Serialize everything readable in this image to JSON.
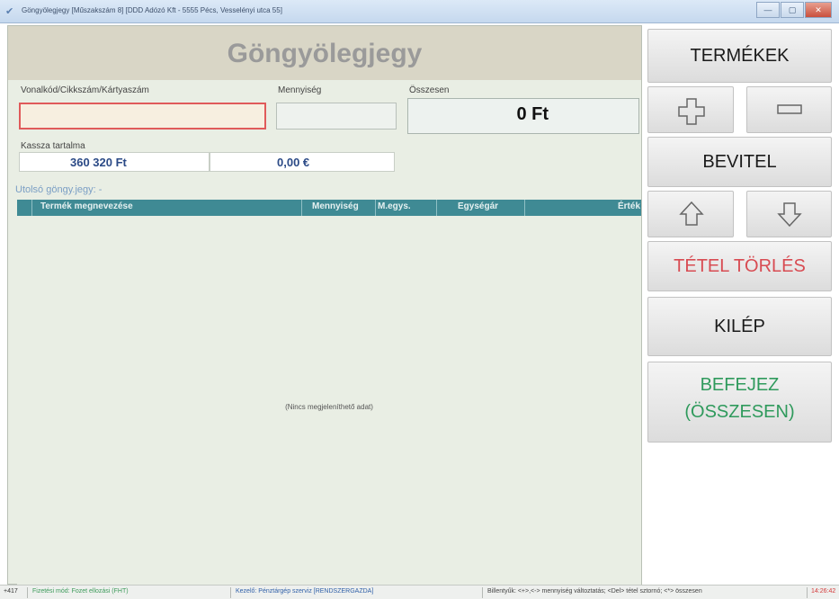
{
  "window": {
    "title": "Göngyölegjegy [Műszakszám 8] [DDD Adózó Kft - 5555 Pécs, Vesselényi utca 55]",
    "buttons": {
      "minimize": "—",
      "maximize": "▢",
      "close": "✕"
    }
  },
  "header": {
    "title": "Göngyölegjegy"
  },
  "form": {
    "barcode": {
      "label": "Vonalkód/Cikkszám/Kártyaszám",
      "value": ""
    },
    "quantity": {
      "label": "Mennyiség",
      "value": ""
    },
    "total": {
      "label": "Összesen",
      "value": "0 Ft"
    }
  },
  "kassza": {
    "label": "Kassza tartalma",
    "huf": "360 320 Ft",
    "eur": "0,00 €"
  },
  "last_ticket": {
    "label": "Utolsó göngy.jegy: -"
  },
  "grid": {
    "columns": [
      "Termék megnevezése",
      "Mennyiség",
      "M.egys.",
      "Egységár",
      "Érték"
    ],
    "empty_text": "(Nincs megjeleníthető adat)"
  },
  "sidebar": {
    "termekek": "TERMÉKEK",
    "plus_icon": "plus-icon",
    "minus_icon": "minus-icon",
    "bevitel": "BEVITEL",
    "up_icon": "arrow-up-icon",
    "down_icon": "arrow-down-icon",
    "tetel_torles": "TÉTEL TÖRLÉS",
    "kilep": "KILÉP",
    "befejez_line1": "BEFEJEZ",
    "befejez_line2": "(ÖSSZESEN)",
    "colors": {
      "delete": "#d84b52",
      "finish": "#2f9a5c"
    }
  },
  "status": {
    "code": "+417",
    "mode": "Fizetési mód: Fozet ellozási (FHT)",
    "user": "Kezelő: Pénztárgép szerviz [RENDSZERGAZDA]",
    "hints": "Billentyűk: <+>,<-> mennyiség változtatás; <Del> tétel sztornó; <*> összesen",
    "time": "14:26:42"
  }
}
